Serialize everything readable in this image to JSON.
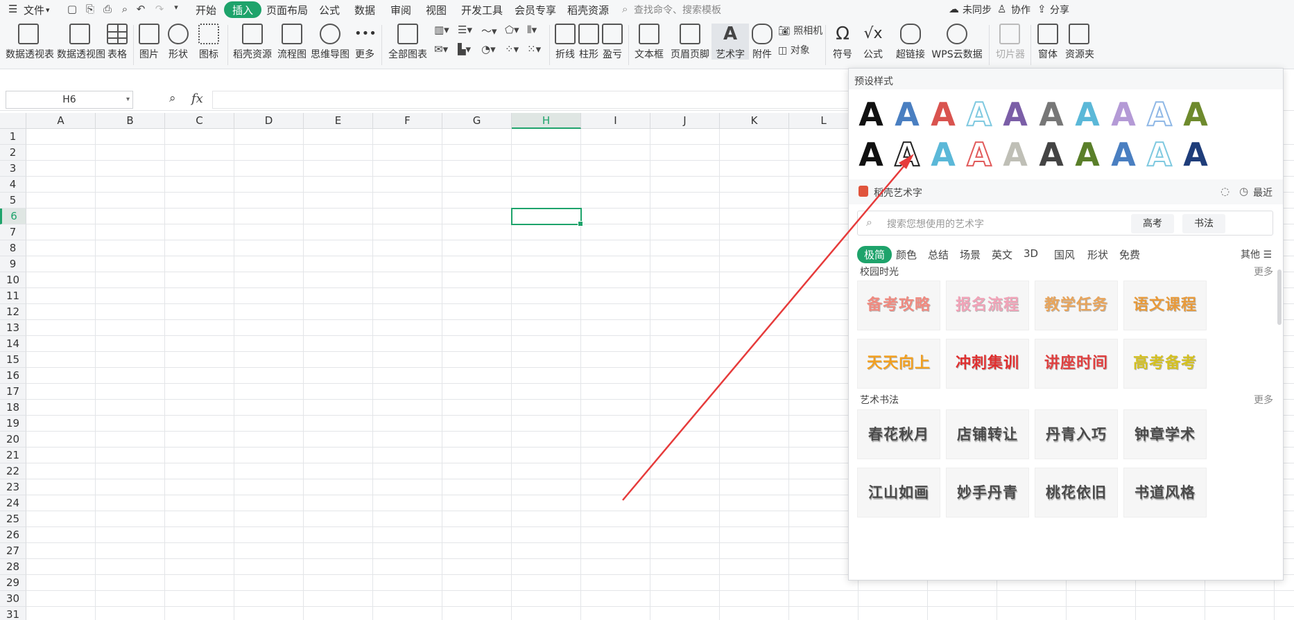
{
  "menubar": {
    "menu_label": "文件",
    "tabs": [
      "开始",
      "插入",
      "页面布局",
      "公式",
      "数据",
      "审阅",
      "视图",
      "开发工具",
      "会员专享",
      "稻壳资源"
    ],
    "search_placeholder": "查找命令、搜索模板",
    "sync": "未同步",
    "collab": "协作",
    "share": "分享"
  },
  "ribbon": {
    "pivot_table": "数据透视表",
    "pivot_chart": "数据透视图",
    "table": "表格",
    "picture": "图片",
    "shape": "形状",
    "icon": "图标",
    "docer": "稻壳资源",
    "flowchart": "流程图",
    "mindmap": "思维导图",
    "more": "更多",
    "all_charts": "全部图表",
    "line": "折线",
    "column": "柱形",
    "winloss": "盈亏",
    "textbox": "文本框",
    "header_footer": "页眉页脚",
    "wordart": "艺术字",
    "attachment": "附件",
    "camera": "照相机",
    "object": "对象",
    "symbol": "符号",
    "formula": "公式",
    "hyperlink": "超链接",
    "wps_cloud": "WPS云数据",
    "slicer": "切片器",
    "window": "窗体",
    "resource": "资源夹"
  },
  "formula_bar": {
    "name_box": "H6",
    "fx": "fx",
    "value": ""
  },
  "grid": {
    "columns": [
      "A",
      "B",
      "C",
      "D",
      "E",
      "F",
      "G",
      "H",
      "I",
      "J",
      "K",
      "L"
    ],
    "rows": [
      "1",
      "2",
      "3",
      "4",
      "5",
      "6",
      "7",
      "8",
      "9",
      "10",
      "11",
      "12",
      "13",
      "14",
      "15",
      "16",
      "17",
      "18",
      "19",
      "20",
      "21",
      "22",
      "23",
      "24",
      "25",
      "26",
      "27",
      "28",
      "29",
      "30",
      "31"
    ],
    "selected_cell": "H6"
  },
  "panel": {
    "preset_title": "预设样式",
    "preset_glyph": "A",
    "preset_colors_row1": [
      "#111111",
      "#4a7fc1",
      "#d9534f",
      "#7fc9e0",
      "#7b5ea7",
      "#777777",
      "#5bb8d8",
      "#b49ad6",
      "#8fb8e6",
      "#6e8a2d"
    ],
    "preset_colors_row2": [
      "#111111",
      "#222222",
      "#5bb8d8",
      "#e15a5a",
      "#bfbfb6",
      "#444444",
      "#5a7f2a",
      "#4a7fc1",
      "#7fc9e0",
      "#1f3d7a"
    ],
    "docer_title": "稻壳艺术字",
    "recent": "最近",
    "search_placeholder": "搜索您想使用的艺术字",
    "btn_gaokao": "高考",
    "btn_shufa": "书法",
    "categories": [
      "极简",
      "颜色",
      "总结",
      "场景",
      "英文",
      "3D",
      "国风",
      "形状",
      "免费"
    ],
    "other": "其他",
    "section1": "校园时光",
    "section2": "艺术书法",
    "more": "更多",
    "campus": [
      "备考攻略",
      "报名流程",
      "教学任务",
      "语文课程",
      "天天向上",
      "冲刺集训",
      "讲座时间",
      "高考备考"
    ],
    "campus_colors": [
      "#f08a80",
      "#f2a3b8",
      "#e8a45a",
      "#e89a3a",
      "#f2a020",
      "#e03030",
      "#e04040",
      "#d4c020"
    ],
    "calligraphy": [
      "春花秋月",
      "店铺转让",
      "丹青入巧",
      "钟章学术",
      "江山如画",
      "妙手丹青",
      "桃花依旧",
      "书道风格"
    ]
  }
}
